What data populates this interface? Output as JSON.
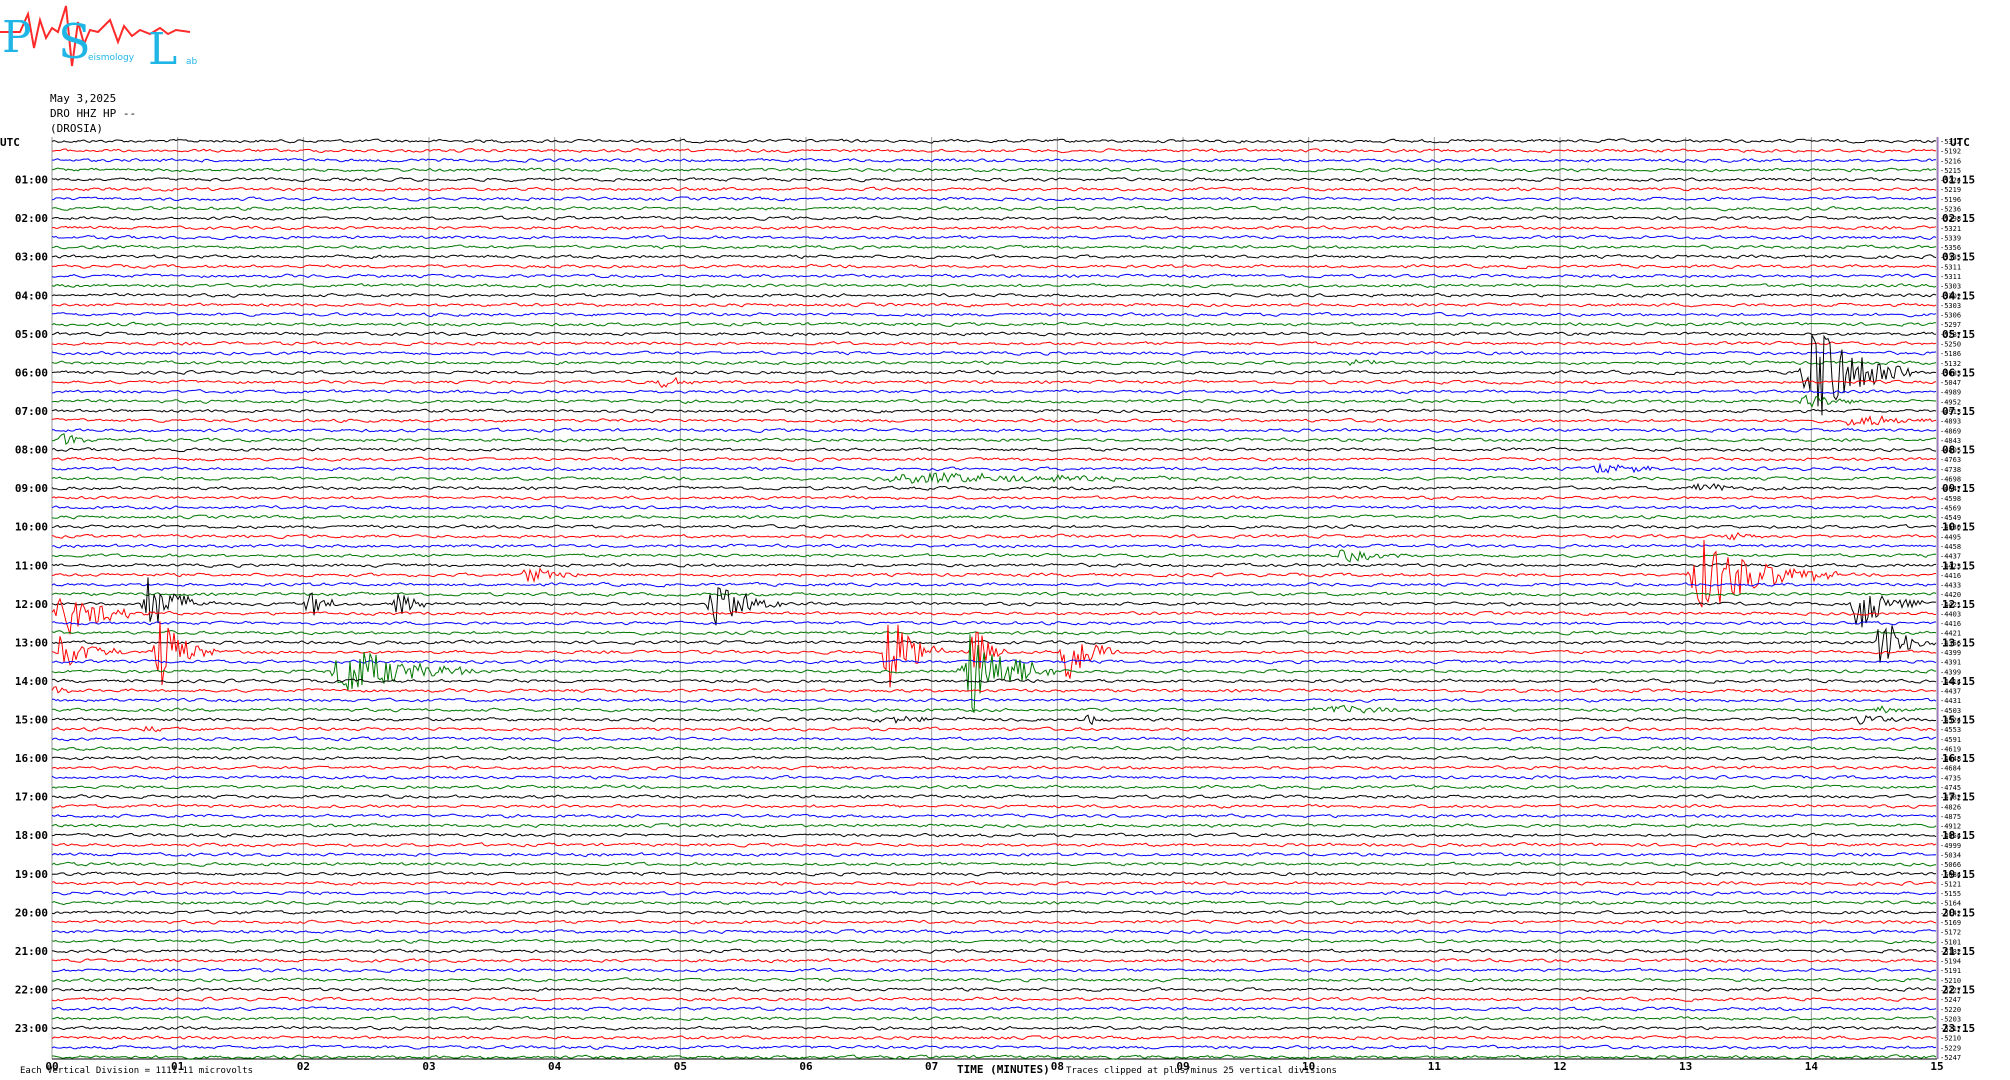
{
  "logo": {
    "letters": [
      "P",
      "S",
      "L"
    ],
    "small_text": [
      "",
      "eismology",
      "ab"
    ]
  },
  "header": {
    "date": "May 3,2025",
    "station": "DRO HHZ HP --",
    "site": "(DROSIA)"
  },
  "axis": {
    "left_label": "UTC",
    "right_label": "UTC",
    "x_title": "TIME (MINUTES)"
  },
  "footer": {
    "scale_note": "Each Vertical Division = 1111.11 microvolts",
    "clip_note": "Traces clipped at plus/minus 25 vertical divisions"
  },
  "colors": [
    "#000000",
    "#ff0000",
    "#0000ff",
    "#007700"
  ],
  "chart_data": {
    "type": "line",
    "title": "",
    "xlabel": "TIME (MINUTES)",
    "ylabel": "UTC",
    "xlim": [
      0,
      15
    ],
    "x_ticks": [
      "00",
      "01",
      "02",
      "03",
      "04",
      "05",
      "06",
      "07",
      "08",
      "09",
      "10",
      "11",
      "12",
      "13",
      "14",
      "15"
    ],
    "trace_minutes": 15,
    "trace_count": 96,
    "left_hour_labels": [
      "01:00",
      "02:00",
      "03:00",
      "04:00",
      "05:00",
      "06:00",
      "07:00",
      "08:00",
      "09:00",
      "10:00",
      "11:00",
      "12:00",
      "13:00",
      "14:00",
      "15:00",
      "16:00",
      "17:00",
      "18:00",
      "19:00",
      "20:00",
      "21:00",
      "22:00",
      "23:00"
    ],
    "right_hour_labels": [
      "01:15",
      "02:15",
      "03:15",
      "04:15",
      "05:15",
      "06:15",
      "07:15",
      "08:15",
      "09:15",
      "10:15",
      "11:15",
      "12:15",
      "13:15",
      "14:15",
      "15:15",
      "16:15",
      "17:15",
      "18:15",
      "19:15",
      "20:15",
      "21:15",
      "22:15",
      "23:15"
    ],
    "trace_offsets": [
      "-5312",
      "-5192",
      "-5216",
      "-5215",
      "-5224",
      "-5219",
      "-5196",
      "-5236",
      "-5298",
      "-5321",
      "-5339",
      "-5356",
      "-5335",
      "-5311",
      "-5311",
      "-5303",
      "-5302",
      "-5303",
      "-5306",
      "-5297",
      "-5287",
      "-5250",
      "-5186",
      "-5132",
      "-5083",
      "-5047",
      "-4989",
      "-4952",
      "-4913",
      "-4893",
      "-4869",
      "-4843",
      "-4805",
      "-4763",
      "-4738",
      "-4698",
      "-4647",
      "-4598",
      "-4569",
      "-4549",
      "-4530",
      "-4495",
      "-4458",
      "-4437",
      "-4423",
      "-4416",
      "-4433",
      "-4420",
      "-4421",
      "-4403",
      "-4416",
      "-4421",
      "-4356",
      "-4399",
      "-4391",
      "-4399",
      "-4414",
      "-4437",
      "-4431",
      "-4503",
      "-4524",
      "-4553",
      "-4591",
      "-4619",
      "-4648",
      "-4684",
      "-4735",
      "-4745",
      "-4782",
      "-4826",
      "-4875",
      "-4912",
      "-4954",
      "-4999",
      "-5034",
      "-5066",
      "-5084",
      "-5121",
      "-5155",
      "-5164",
      "-5142",
      "-5169",
      "-5172",
      "-5101",
      "-5182",
      "-5194",
      "-5191",
      "-5210",
      "-5227",
      "-5247",
      "-5220",
      "-5203",
      "-5217",
      "-5210",
      "-5229",
      "-5247",
      "-5281"
    ],
    "events": [
      {
        "trace": 24,
        "minute": 13.9,
        "amp": 60,
        "dur": 0.9
      },
      {
        "trace": 23,
        "minute": 10.3,
        "amp": 6,
        "dur": 0.3
      },
      {
        "trace": 25,
        "minute": 4.8,
        "amp": 6,
        "dur": 0.5
      },
      {
        "trace": 27,
        "minute": 13.9,
        "amp": 10,
        "dur": 0.5
      },
      {
        "trace": 29,
        "minute": 14.2,
        "amp": 8,
        "dur": 1.0
      },
      {
        "trace": 31,
        "minute": 0.05,
        "amp": 8,
        "dur": 0.3
      },
      {
        "trace": 35,
        "minute": 6.5,
        "amp": 6,
        "dur": 3.0
      },
      {
        "trace": 34,
        "minute": 12.2,
        "amp": 5,
        "dur": 1.0
      },
      {
        "trace": 36,
        "minute": 13.0,
        "amp": 4,
        "dur": 1.0
      },
      {
        "trace": 41,
        "minute": 13.3,
        "amp": 5,
        "dur": 0.5
      },
      {
        "trace": 43,
        "minute": 10.2,
        "amp": 8,
        "dur": 0.6
      },
      {
        "trace": 45,
        "minute": 3.7,
        "amp": 8,
        "dur": 0.7
      },
      {
        "trace": 45,
        "minute": 13.0,
        "amp": 40,
        "dur": 1.2
      },
      {
        "trace": 48,
        "minute": 0.7,
        "amp": 30,
        "dur": 0.6
      },
      {
        "trace": 48,
        "minute": 2.0,
        "amp": 18,
        "dur": 0.3
      },
      {
        "trace": 48,
        "minute": 2.7,
        "amp": 18,
        "dur": 0.3
      },
      {
        "trace": 48,
        "minute": 5.2,
        "amp": 30,
        "dur": 0.6
      },
      {
        "trace": 48,
        "minute": 14.3,
        "amp": 30,
        "dur": 0.6
      },
      {
        "trace": 49,
        "minute": 0.0,
        "amp": 25,
        "dur": 0.8
      },
      {
        "trace": 52,
        "minute": 14.5,
        "amp": 28,
        "dur": 0.5
      },
      {
        "trace": 53,
        "minute": 0.0,
        "amp": 20,
        "dur": 0.6
      },
      {
        "trace": 53,
        "minute": 0.8,
        "amp": 40,
        "dur": 0.5
      },
      {
        "trace": 53,
        "minute": 6.6,
        "amp": 45,
        "dur": 0.5
      },
      {
        "trace": 53,
        "minute": 7.3,
        "amp": 30,
        "dur": 0.3
      },
      {
        "trace": 53,
        "minute": 8.0,
        "amp": 40,
        "dur": 0.5
      },
      {
        "trace": 55,
        "minute": 2.2,
        "amp": 28,
        "dur": 1.2
      },
      {
        "trace": 55,
        "minute": 7.2,
        "amp": 50,
        "dur": 0.8
      },
      {
        "trace": 57,
        "minute": 0.0,
        "amp": 6,
        "dur": 0.2
      },
      {
        "trace": 59,
        "minute": 10.0,
        "amp": 4,
        "dur": 1.5
      },
      {
        "trace": 59,
        "minute": 14.5,
        "amp": 4,
        "dur": 0.5
      },
      {
        "trace": 60,
        "minute": 6.5,
        "amp": 4,
        "dur": 1.0
      },
      {
        "trace": 60,
        "minute": 8.2,
        "amp": 6,
        "dur": 0.4
      },
      {
        "trace": 60,
        "minute": 14.3,
        "amp": 6,
        "dur": 0.6
      },
      {
        "trace": 61,
        "minute": 0.7,
        "amp": 4,
        "dur": 0.4
      }
    ]
  }
}
